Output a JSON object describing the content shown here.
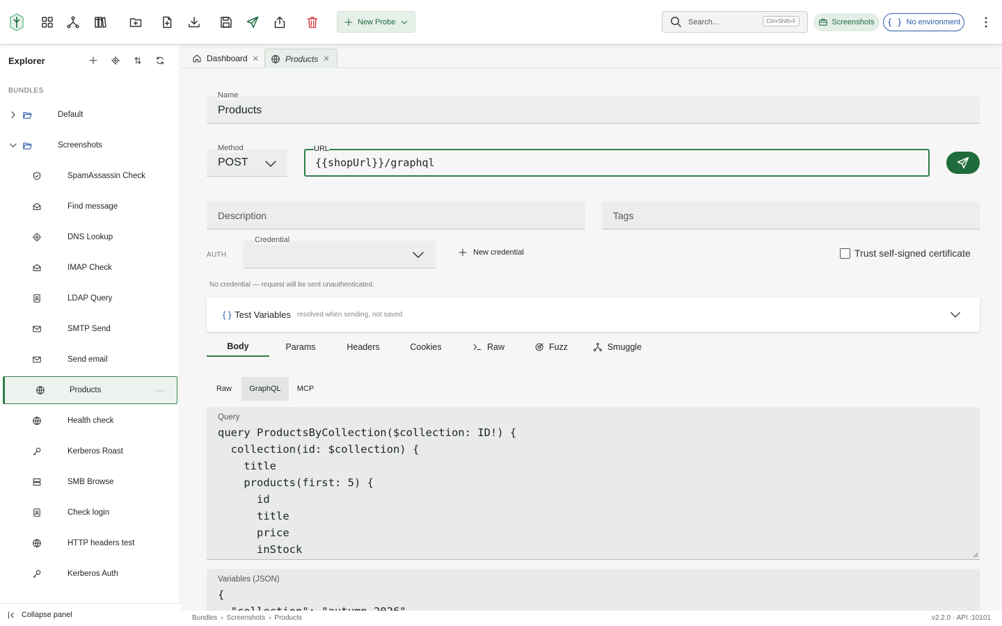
{
  "toolbar": {
    "new_probe_label": "New Probe",
    "search_placeholder": "Search...",
    "search_shortcut": "Ctrl+Shift+F",
    "workspace_label": "Screenshots",
    "environment_label": "No environment",
    "accent_color": "#1e6b3c",
    "env_color": "#2b5ba8",
    "delete_color": "#d64545"
  },
  "sidebar": {
    "title": "Explorer",
    "bundles_label": "BUNDLES",
    "folders": [
      {
        "label": "Default",
        "expanded": false
      },
      {
        "label": "Screenshots",
        "expanded": true
      }
    ],
    "items": [
      {
        "label": "SpamAssassin Check",
        "icon": "shield-icon"
      },
      {
        "label": "Find message",
        "icon": "envelope-open-icon"
      },
      {
        "label": "DNS Lookup",
        "icon": "target-icon"
      },
      {
        "label": "IMAP Check",
        "icon": "envelope-open-icon"
      },
      {
        "label": "LDAP Query",
        "icon": "contact-book-icon"
      },
      {
        "label": "SMTP Send",
        "icon": "mail-icon"
      },
      {
        "label": "Send email",
        "icon": "mail-icon"
      },
      {
        "label": "Products",
        "icon": "globe-icon",
        "active": true
      },
      {
        "label": "Health check",
        "icon": "globe-icon"
      },
      {
        "label": "Kerberos Roast",
        "icon": "key-icon"
      },
      {
        "label": "SMB Browse",
        "icon": "server-icon"
      },
      {
        "label": "Check login",
        "icon": "contact-book-icon"
      },
      {
        "label": "HTTP headers test",
        "icon": "globe-icon"
      },
      {
        "label": "Kerberos Auth",
        "icon": "key-icon"
      }
    ],
    "collapse_label": "Collapse panel"
  },
  "tabs": [
    {
      "label": "Dashboard",
      "icon": "home-icon"
    },
    {
      "label": "Products",
      "icon": "globe-icon",
      "active": true
    }
  ],
  "form": {
    "name_label": "Name",
    "name_value": "Products",
    "method_label": "Method",
    "method_value": "POST",
    "url_label": "URL",
    "url_value": "{{shopUrl}}/graphql",
    "description_placeholder": "Description",
    "tags_placeholder": "Tags",
    "auth_label": "AUTH",
    "credential_label": "Credential",
    "credential_value": "",
    "new_credential_label": "New credential",
    "trust_label": "Trust self-signed certificate",
    "trust_checked": false,
    "credential_hint": "No credential — request will be sent unauthenticated."
  },
  "test_vars": {
    "braces": "{ }",
    "title": "Test Variables",
    "subtitle": "resolved when sending, not saved"
  },
  "request_tabs": [
    {
      "label": "Body",
      "active": true
    },
    {
      "label": "Params"
    },
    {
      "label": "Headers"
    },
    {
      "label": "Cookies"
    },
    {
      "label": "Raw",
      "icon": "terminal-icon"
    },
    {
      "label": "Fuzz",
      "icon": "target-icon"
    },
    {
      "label": "Smuggle",
      "icon": "graph-icon"
    }
  ],
  "body_tabs": [
    {
      "label": "Raw"
    },
    {
      "label": "GraphQL",
      "active": true
    },
    {
      "label": "MCP"
    }
  ],
  "query": {
    "label": "Query",
    "code": "query ProductsByCollection($collection: ID!) {\n  collection(id: $collection) {\n    title\n    products(first: 5) {\n      id\n      title\n      price\n      inStock"
  },
  "variables": {
    "label": "Variables (JSON)",
    "code": "{\n  \"collection\": \"autumn-2026\""
  },
  "statusbar": {
    "breadcrumbs": [
      "Bundles",
      "Screenshots",
      "Products"
    ],
    "version": "v2.2.0 · API :10101"
  }
}
